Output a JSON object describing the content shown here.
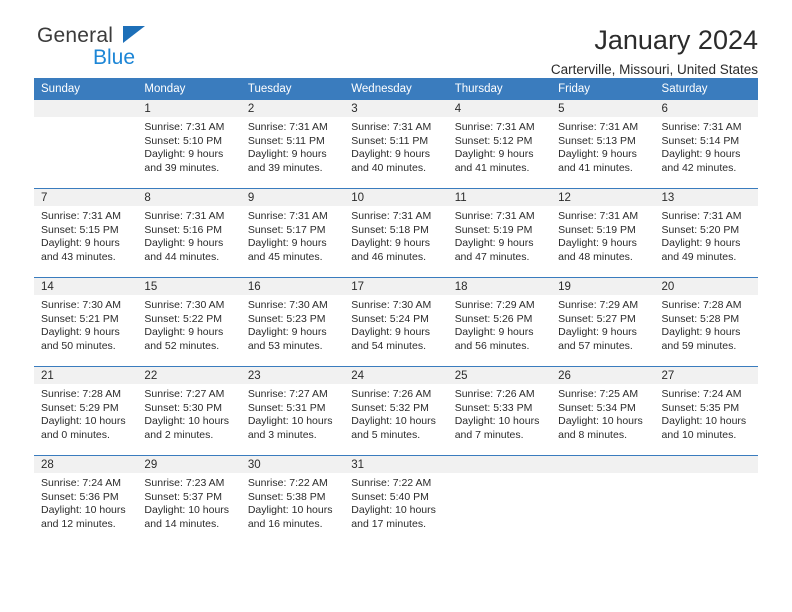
{
  "brand": {
    "name_top": "General",
    "name_bottom": "Blue",
    "accent_blue": "#1d86d6",
    "triangle_blue": "#1d6fb8"
  },
  "header": {
    "title": "January 2024",
    "location": "Carterville, Missouri, United States",
    "header_bg": "#3a7cbe",
    "header_text": "#ffffff",
    "daynum_band_bg": "#f1f1f1"
  },
  "weekday_headers": [
    "Sunday",
    "Monday",
    "Tuesday",
    "Wednesday",
    "Thursday",
    "Friday",
    "Saturday"
  ],
  "weeks": [
    [
      {
        "day": "",
        "sunrise": "",
        "sunset": "",
        "daylight1": "",
        "daylight2": ""
      },
      {
        "day": "1",
        "sunrise": "Sunrise: 7:31 AM",
        "sunset": "Sunset: 5:10 PM",
        "daylight1": "Daylight: 9 hours",
        "daylight2": "and 39 minutes."
      },
      {
        "day": "2",
        "sunrise": "Sunrise: 7:31 AM",
        "sunset": "Sunset: 5:11 PM",
        "daylight1": "Daylight: 9 hours",
        "daylight2": "and 39 minutes."
      },
      {
        "day": "3",
        "sunrise": "Sunrise: 7:31 AM",
        "sunset": "Sunset: 5:11 PM",
        "daylight1": "Daylight: 9 hours",
        "daylight2": "and 40 minutes."
      },
      {
        "day": "4",
        "sunrise": "Sunrise: 7:31 AM",
        "sunset": "Sunset: 5:12 PM",
        "daylight1": "Daylight: 9 hours",
        "daylight2": "and 41 minutes."
      },
      {
        "day": "5",
        "sunrise": "Sunrise: 7:31 AM",
        "sunset": "Sunset: 5:13 PM",
        "daylight1": "Daylight: 9 hours",
        "daylight2": "and 41 minutes."
      },
      {
        "day": "6",
        "sunrise": "Sunrise: 7:31 AM",
        "sunset": "Sunset: 5:14 PM",
        "daylight1": "Daylight: 9 hours",
        "daylight2": "and 42 minutes."
      }
    ],
    [
      {
        "day": "7",
        "sunrise": "Sunrise: 7:31 AM",
        "sunset": "Sunset: 5:15 PM",
        "daylight1": "Daylight: 9 hours",
        "daylight2": "and 43 minutes."
      },
      {
        "day": "8",
        "sunrise": "Sunrise: 7:31 AM",
        "sunset": "Sunset: 5:16 PM",
        "daylight1": "Daylight: 9 hours",
        "daylight2": "and 44 minutes."
      },
      {
        "day": "9",
        "sunrise": "Sunrise: 7:31 AM",
        "sunset": "Sunset: 5:17 PM",
        "daylight1": "Daylight: 9 hours",
        "daylight2": "and 45 minutes."
      },
      {
        "day": "10",
        "sunrise": "Sunrise: 7:31 AM",
        "sunset": "Sunset: 5:18 PM",
        "daylight1": "Daylight: 9 hours",
        "daylight2": "and 46 minutes."
      },
      {
        "day": "11",
        "sunrise": "Sunrise: 7:31 AM",
        "sunset": "Sunset: 5:19 PM",
        "daylight1": "Daylight: 9 hours",
        "daylight2": "and 47 minutes."
      },
      {
        "day": "12",
        "sunrise": "Sunrise: 7:31 AM",
        "sunset": "Sunset: 5:19 PM",
        "daylight1": "Daylight: 9 hours",
        "daylight2": "and 48 minutes."
      },
      {
        "day": "13",
        "sunrise": "Sunrise: 7:31 AM",
        "sunset": "Sunset: 5:20 PM",
        "daylight1": "Daylight: 9 hours",
        "daylight2": "and 49 minutes."
      }
    ],
    [
      {
        "day": "14",
        "sunrise": "Sunrise: 7:30 AM",
        "sunset": "Sunset: 5:21 PM",
        "daylight1": "Daylight: 9 hours",
        "daylight2": "and 50 minutes."
      },
      {
        "day": "15",
        "sunrise": "Sunrise: 7:30 AM",
        "sunset": "Sunset: 5:22 PM",
        "daylight1": "Daylight: 9 hours",
        "daylight2": "and 52 minutes."
      },
      {
        "day": "16",
        "sunrise": "Sunrise: 7:30 AM",
        "sunset": "Sunset: 5:23 PM",
        "daylight1": "Daylight: 9 hours",
        "daylight2": "and 53 minutes."
      },
      {
        "day": "17",
        "sunrise": "Sunrise: 7:30 AM",
        "sunset": "Sunset: 5:24 PM",
        "daylight1": "Daylight: 9 hours",
        "daylight2": "and 54 minutes."
      },
      {
        "day": "18",
        "sunrise": "Sunrise: 7:29 AM",
        "sunset": "Sunset: 5:26 PM",
        "daylight1": "Daylight: 9 hours",
        "daylight2": "and 56 minutes."
      },
      {
        "day": "19",
        "sunrise": "Sunrise: 7:29 AM",
        "sunset": "Sunset: 5:27 PM",
        "daylight1": "Daylight: 9 hours",
        "daylight2": "and 57 minutes."
      },
      {
        "day": "20",
        "sunrise": "Sunrise: 7:28 AM",
        "sunset": "Sunset: 5:28 PM",
        "daylight1": "Daylight: 9 hours",
        "daylight2": "and 59 minutes."
      }
    ],
    [
      {
        "day": "21",
        "sunrise": "Sunrise: 7:28 AM",
        "sunset": "Sunset: 5:29 PM",
        "daylight1": "Daylight: 10 hours",
        "daylight2": "and 0 minutes."
      },
      {
        "day": "22",
        "sunrise": "Sunrise: 7:27 AM",
        "sunset": "Sunset: 5:30 PM",
        "daylight1": "Daylight: 10 hours",
        "daylight2": "and 2 minutes."
      },
      {
        "day": "23",
        "sunrise": "Sunrise: 7:27 AM",
        "sunset": "Sunset: 5:31 PM",
        "daylight1": "Daylight: 10 hours",
        "daylight2": "and 3 minutes."
      },
      {
        "day": "24",
        "sunrise": "Sunrise: 7:26 AM",
        "sunset": "Sunset: 5:32 PM",
        "daylight1": "Daylight: 10 hours",
        "daylight2": "and 5 minutes."
      },
      {
        "day": "25",
        "sunrise": "Sunrise: 7:26 AM",
        "sunset": "Sunset: 5:33 PM",
        "daylight1": "Daylight: 10 hours",
        "daylight2": "and 7 minutes."
      },
      {
        "day": "26",
        "sunrise": "Sunrise: 7:25 AM",
        "sunset": "Sunset: 5:34 PM",
        "daylight1": "Daylight: 10 hours",
        "daylight2": "and 8 minutes."
      },
      {
        "day": "27",
        "sunrise": "Sunrise: 7:24 AM",
        "sunset": "Sunset: 5:35 PM",
        "daylight1": "Daylight: 10 hours",
        "daylight2": "and 10 minutes."
      }
    ],
    [
      {
        "day": "28",
        "sunrise": "Sunrise: 7:24 AM",
        "sunset": "Sunset: 5:36 PM",
        "daylight1": "Daylight: 10 hours",
        "daylight2": "and 12 minutes."
      },
      {
        "day": "29",
        "sunrise": "Sunrise: 7:23 AM",
        "sunset": "Sunset: 5:37 PM",
        "daylight1": "Daylight: 10 hours",
        "daylight2": "and 14 minutes."
      },
      {
        "day": "30",
        "sunrise": "Sunrise: 7:22 AM",
        "sunset": "Sunset: 5:38 PM",
        "daylight1": "Daylight: 10 hours",
        "daylight2": "and 16 minutes."
      },
      {
        "day": "31",
        "sunrise": "Sunrise: 7:22 AM",
        "sunset": "Sunset: 5:40 PM",
        "daylight1": "Daylight: 10 hours",
        "daylight2": "and 17 minutes."
      },
      {
        "day": "",
        "sunrise": "",
        "sunset": "",
        "daylight1": "",
        "daylight2": ""
      },
      {
        "day": "",
        "sunrise": "",
        "sunset": "",
        "daylight1": "",
        "daylight2": ""
      },
      {
        "day": "",
        "sunrise": "",
        "sunset": "",
        "daylight1": "",
        "daylight2": ""
      }
    ]
  ]
}
